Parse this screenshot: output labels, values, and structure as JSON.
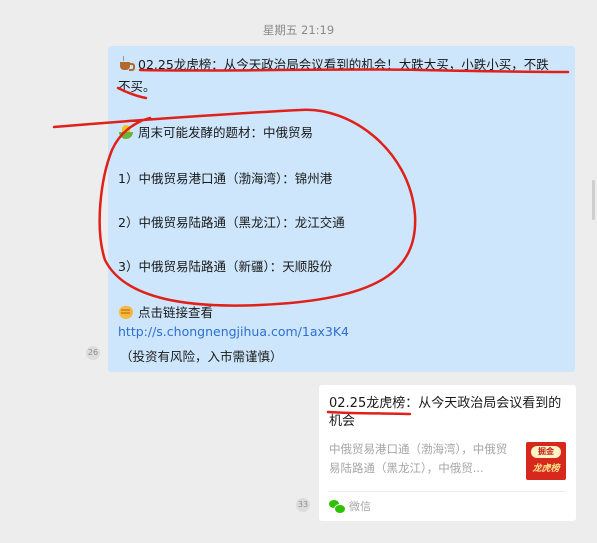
{
  "timestamp": "星期五 21:19",
  "message": {
    "title_prefix": "02.25龙虎榜",
    "title_rest": "：从今天政治局会议看到的机会！大跌大买，小跌小买，不跌",
    "title_line2": "不买。",
    "topic_label": "周末可能发酵的题材：中俄贸易",
    "items": [
      "1）中俄贸易港口通（渤海湾）：锦州港",
      "2）中俄贸易陆路通（黑龙江）：龙江交通",
      "3）中俄贸易陆路通（新疆）：天顺股份"
    ],
    "click_text": "点击链接查看",
    "link_url": "http://s.chongnengjihua.com/1ax3K4",
    "disclaimer": "（投资有风险，入市需谨慎）",
    "badge": "26"
  },
  "card": {
    "title_prefix": "02.25龙虎榜",
    "title_rest": "：从今天政治局会议看到的机会",
    "desc": "中俄贸易港口通（渤海湾），中俄贸易陆路通（黑龙江），中俄贸...",
    "thumb_top": "掘金",
    "thumb_bottom": "龙虎榜",
    "source": "微信",
    "badge": "33"
  },
  "icons": {
    "cup": "coffee-icon",
    "corn": "corn-icon",
    "hand": "fist-icon",
    "wechat": "wechat-icon"
  },
  "colors": {
    "bubble": "#cde6fb",
    "link": "#2f6fcf",
    "annotation": "#e0201a",
    "background": "#ededed"
  }
}
